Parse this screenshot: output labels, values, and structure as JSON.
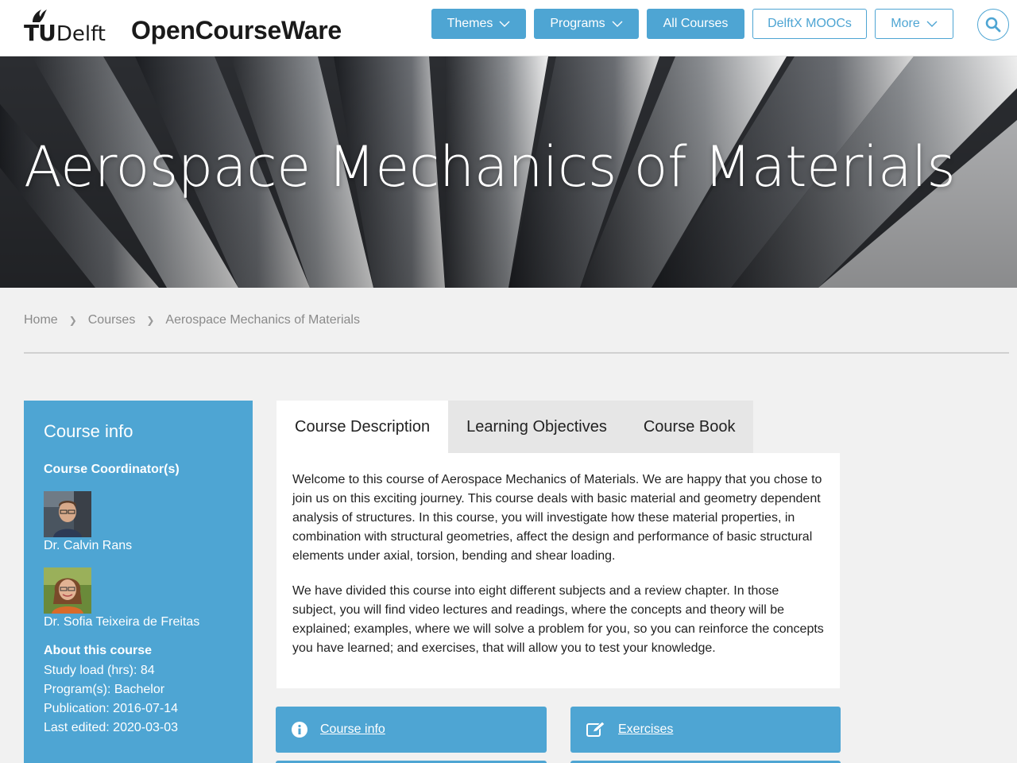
{
  "header": {
    "logo_tu": "TU",
    "logo_delft": "Delft",
    "site_title": "OpenCourseWare",
    "nav": [
      {
        "label": "Themes",
        "dropdown": true
      },
      {
        "label": "Programs",
        "dropdown": true
      },
      {
        "label": "All Courses",
        "dropdown": false
      },
      {
        "label": "DelftX MOOCs",
        "dropdown": false
      },
      {
        "label": "More",
        "dropdown": true
      }
    ],
    "search_icon": "search-icon"
  },
  "hero": {
    "title": "Aerospace Mechanics of Materials"
  },
  "breadcrumb": [
    "Home",
    "Courses",
    "Aerospace Mechanics of Materials"
  ],
  "sidebar": {
    "title": "Course info",
    "coordinators_heading": "Course Coordinator(s)",
    "coordinators": [
      "Dr. Calvin Rans",
      "Dr. Sofia Teixeira de Freitas"
    ],
    "about_heading": "About this course",
    "about": [
      "Study load (hrs): 84",
      "Program(s): Bachelor",
      "Publication: 2016-07-14",
      "Last edited: 2020-03-03"
    ]
  },
  "tabs": [
    "Course Description",
    "Learning Objectives",
    "Course Book"
  ],
  "description": [
    "Welcome to this course of Aerospace Mechanics of Materials. We are happy that you chose to join us on this exciting journey. This course deals with basic material and geometry dependent analysis of structures. In this course, you will investigate how these material properties, in combination with structural geometries, affect the design and performance of basic structural elements under axial, torsion, bending and shear loading.",
    "We have divided this course into eight different subjects and a review chapter. In those subject, you will find video lectures and readings, where the concepts and theory will be explained; examples, where we will solve a problem for you, so you can reinforce the concepts you have learned; and exercises, that will allow you to test your knowledge."
  ],
  "cards": [
    {
      "label": "Course info",
      "icon": "info-icon"
    },
    {
      "label": "Exercises",
      "icon": "edit-icon"
    }
  ],
  "colors": {
    "accent": "#4ea5d3",
    "background": "#f1f1f1"
  }
}
